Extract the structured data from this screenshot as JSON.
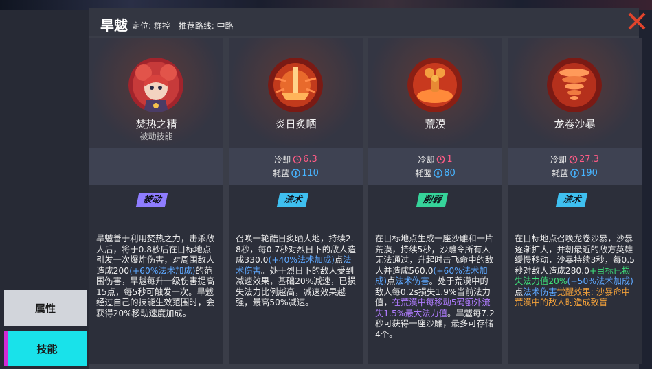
{
  "hero": {
    "name": "旱魃",
    "role": "定位: 群控",
    "lane": "推荐路线: 中路"
  },
  "tabs": [
    {
      "label": "属性",
      "active": false
    },
    {
      "label": "技能",
      "active": true
    }
  ],
  "colors": {
    "accent_cyan": "#19e2ea",
    "accent_magenta": "#d12bd5",
    "cooldown": "#ff5c86",
    "mana": "#47b4ff"
  },
  "skills": [
    {
      "name": "焚热之精",
      "sub": "被动技能",
      "icon": "hero-portrait-icon",
      "tag": "被动",
      "tag_color": "#8f7dff",
      "desc": [
        {
          "t": "旱魃善于利用焚热之力，击杀敌人后，将于0.8秒后在目标地点引发一次爆炸伤害，对周围敌人造成200",
          "c": ""
        },
        {
          "t": "(+60%法术加成)",
          "c": "b"
        },
        {
          "t": "的范围伤害，旱魃每升一级伤害提高15点，每5秒可触发一次。旱魃经过自己的技能生效范围时，会获得20%移动速度加成。",
          "c": ""
        }
      ]
    },
    {
      "name": "炎日炙晒",
      "cooldown_label": "冷却",
      "cooldown": "6.3",
      "mana_label": "耗蓝",
      "mana": "110",
      "icon": "sun-burn-icon",
      "tag": "法术",
      "tag_color": "#3fc0f0",
      "desc": [
        {
          "t": "召唤一轮酷日炙晒大地，持续2.8秒，每0.7秒对烈日下的敌人造成330.0",
          "c": ""
        },
        {
          "t": "(+40%法术加成)",
          "c": "b"
        },
        {
          "t": "点",
          "c": ""
        },
        {
          "t": "法术伤害",
          "c": "b"
        },
        {
          "t": "。处于烈日下的敌人受到减速效果，基础20%减速，已损失法力比例越高，减速效果越强，最高50%减速。",
          "c": ""
        }
      ]
    },
    {
      "name": "荒漠",
      "cooldown_label": "冷却",
      "cooldown": "1",
      "mana_label": "耗蓝",
      "mana": "80",
      "icon": "desert-statue-icon",
      "tag": "削弱",
      "tag_color": "#36d49a",
      "desc": [
        {
          "t": "在目标地点生成一座沙雕和一片荒漠，持续5秒，沙雕令所有人无法通过，升起时击飞命中的敌人并造成560.0",
          "c": ""
        },
        {
          "t": "(+60%法术加成)",
          "c": "b"
        },
        {
          "t": "点",
          "c": ""
        },
        {
          "t": "法术伤害",
          "c": "b"
        },
        {
          "t": "。处于荒漠中的敌人每0.2s损失1.9%当前法力值，",
          "c": ""
        },
        {
          "t": "在荒漠中每移动5码额外流失1.5%最大法力值",
          "c": "p"
        },
        {
          "t": "。旱魃每7.2秒可获得一座沙雕，最多可存储4个。",
          "c": ""
        }
      ]
    },
    {
      "name": "龙卷沙暴",
      "cooldown_label": "冷却",
      "cooldown": "27.3",
      "mana_label": "耗蓝",
      "mana": "190",
      "icon": "sandstorm-tornado-icon",
      "tag": "法术",
      "tag_color": "#3fc0f0",
      "desc": [
        {
          "t": "在目标地点召唤龙卷沙暴，沙暴逐渐扩大，并朝最近的敌方英雄缓慢移动，沙暴持续3秒，每0.5秒对敌人造成280.0",
          "c": ""
        },
        {
          "t": "+目标已损失法力值20%",
          "c": "g"
        },
        {
          "t": "(+50%法术加成)",
          "c": "b"
        },
        {
          "t": "点",
          "c": ""
        },
        {
          "t": "法术伤害",
          "c": "b"
        },
        {
          "t": "觉醒效果: 沙暴命中荒漠中的敌人时造成致盲",
          "c": "o"
        }
      ]
    }
  ]
}
